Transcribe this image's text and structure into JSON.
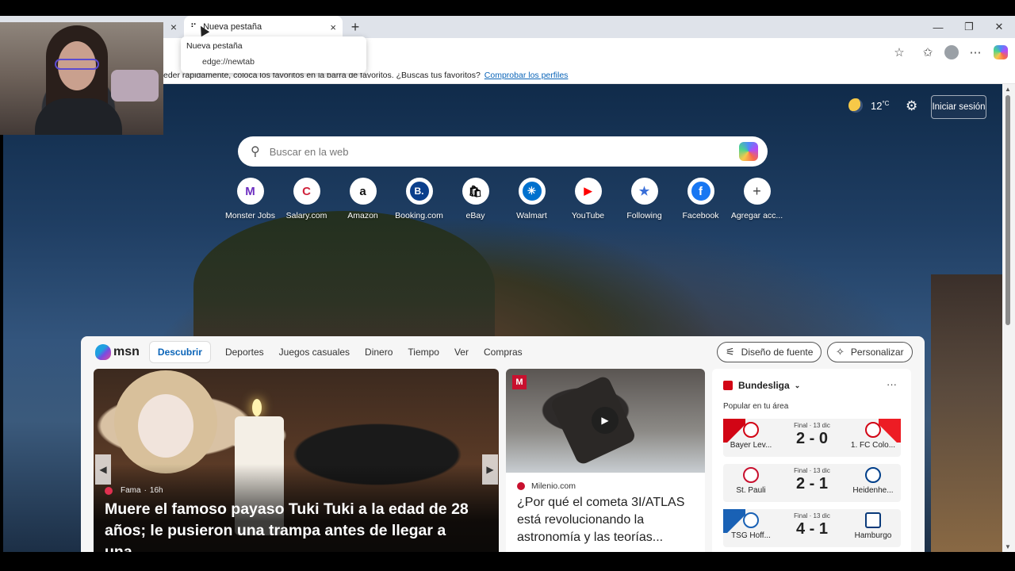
{
  "browser": {
    "tab_prev_close": "×",
    "active_tab_title": "Nueva pestaña",
    "tab_close": "×",
    "new_tab": "+",
    "tooltip": {
      "title": "Nueva pestaña",
      "url": "edge://newtab"
    },
    "window": {
      "minimize": "—",
      "restore": "❐",
      "close": "✕"
    },
    "favbar": {
      "message": "eder rápidamente, coloca los favoritos en la barra de favoritos. ¿Buscas tus favoritos?",
      "link": "Comprobar los perfiles"
    }
  },
  "header": {
    "temperature": "12",
    "unit": "°C",
    "signin": "Iniciar sesión"
  },
  "search": {
    "placeholder": "Buscar en la web"
  },
  "quicklinks": [
    {
      "label": "Monster Jobs",
      "glyph": "M",
      "color": "#6d2ec0"
    },
    {
      "label": "Salary.com",
      "glyph": "C",
      "color": "#d0233b"
    },
    {
      "label": "Amazon",
      "glyph": "a",
      "color": "#111111"
    },
    {
      "label": "Booking.com",
      "glyph": "B.",
      "color": "#0b3f8c"
    },
    {
      "label": "eBay",
      "glyph": "🛍",
      "color": "#2a2a2a"
    },
    {
      "label": "Walmart",
      "glyph": "✳",
      "color": "#0071ce"
    },
    {
      "label": "YouTube",
      "glyph": "▶",
      "color": "#ff0000"
    },
    {
      "label": "Following",
      "glyph": "★",
      "color": "#3a6fd8"
    },
    {
      "label": "Facebook",
      "glyph": "f",
      "color": "#1877f2"
    },
    {
      "label": "Agregar acc...",
      "glyph": "+",
      "color": "#444444"
    }
  ],
  "feed": {
    "logo": "msn",
    "nav": [
      "Descubrir",
      "Deportes",
      "Juegos casuales",
      "Dinero",
      "Tiempo",
      "Ver",
      "Compras"
    ],
    "font_button": "Diseño de fuente",
    "personalize_button": "Personalizar",
    "hero": {
      "source": "Fama",
      "time": "16h",
      "title": "Muere el famoso payaso Tuki Tuki a la edad de 28 años; le pusieron una trampa antes de llegar a una..."
    },
    "card2": {
      "logo": "M",
      "source": "Milenio.com",
      "title": "¿Por qué el cometa 3I/ATLAS está revolucionando la astronomía y las teorías..."
    },
    "sports": {
      "league": "Bundesliga",
      "more": "···",
      "subtitle": "Popular en tu área",
      "matches": [
        {
          "home": "Bayer Lev...",
          "away": "1. FC Colo...",
          "state": "Final · 13 dic",
          "score": "2 - 0"
        },
        {
          "home": "St. Pauli",
          "away": "Heidenhe...",
          "state": "Final · 13 dic",
          "score": "2 - 1"
        },
        {
          "home": "TSG Hoff...",
          "away": "Hamburgo",
          "state": "Final · 13 dic",
          "score": "4 - 1"
        }
      ]
    }
  }
}
